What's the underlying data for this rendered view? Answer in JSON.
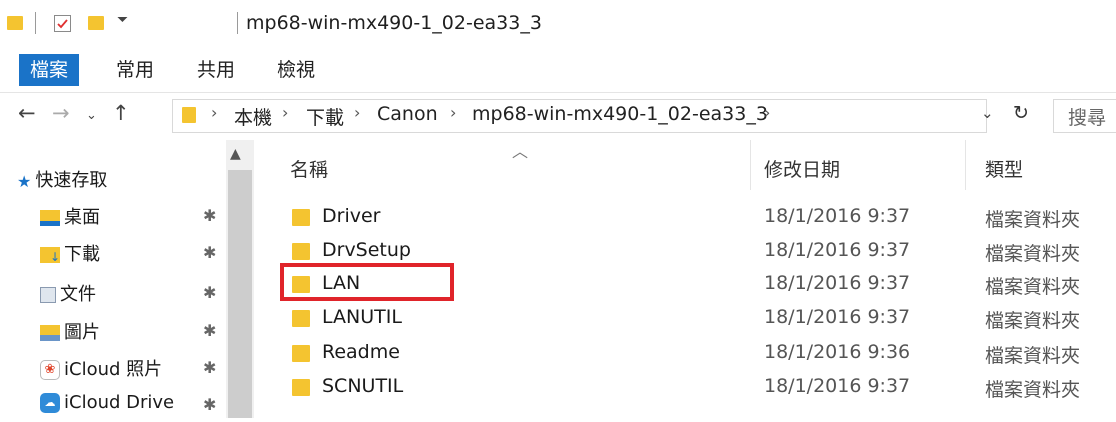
{
  "title": "mp68-win-mx490-1_02-ea33_3",
  "ribbon": {
    "tabs": [
      "檔案",
      "常用",
      "共用",
      "檢視"
    ]
  },
  "address": {
    "crumbs": [
      "本機",
      "下載",
      "Canon",
      "mp68-win-mx490-1_02-ea33_3"
    ],
    "search_placeholder": "搜尋"
  },
  "sidebar": {
    "items": [
      {
        "label": "快速存取",
        "icon": "star-icon",
        "pinned": false
      },
      {
        "label": "桌面",
        "icon": "desktop-icon",
        "pinned": true
      },
      {
        "label": "下載",
        "icon": "downloads-icon",
        "pinned": true
      },
      {
        "label": "文件",
        "icon": "documents-icon",
        "pinned": true
      },
      {
        "label": "圖片",
        "icon": "pictures-icon",
        "pinned": true
      },
      {
        "label": "iCloud 照片",
        "icon": "icloud-photos-icon",
        "pinned": true
      },
      {
        "label": "iCloud Drive",
        "icon": "icloud-drive-icon",
        "pinned": true
      }
    ]
  },
  "columns": {
    "name": "名稱",
    "date": "修改日期",
    "type": "類型"
  },
  "files": [
    {
      "name": "Driver",
      "date": "18/1/2016 9:37",
      "type": "檔案資料夾"
    },
    {
      "name": "DrvSetup",
      "date": "18/1/2016 9:37",
      "type": "檔案資料夾"
    },
    {
      "name": "LAN",
      "date": "18/1/2016 9:37",
      "type": "檔案資料夾"
    },
    {
      "name": "LANUTIL",
      "date": "18/1/2016 9:37",
      "type": "檔案資料夾"
    },
    {
      "name": "Readme",
      "date": "18/1/2016 9:36",
      "type": "檔案資料夾"
    },
    {
      "name": "SCNUTIL",
      "date": "18/1/2016 9:37",
      "type": "檔案資料夾"
    }
  ],
  "colors": {
    "accent": "#1a73c8",
    "folder": "#f4c430",
    "highlight": "#e0242a"
  }
}
